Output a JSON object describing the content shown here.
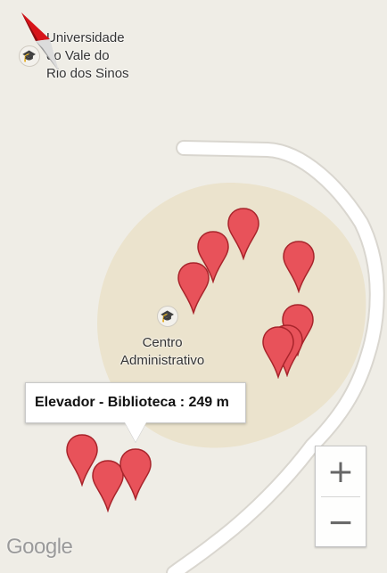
{
  "map": {
    "pois": [
      {
        "label": "Universidade\ndo Vale do\nRio dos Sinos",
        "icon": "graduation-cap-icon"
      },
      {
        "label": "Centro\nAdministrativo",
        "icon": "graduation-cap-icon"
      }
    ],
    "marker_color": "#e8525a",
    "campus_color": "#ebe3cd",
    "road_color": "#ffffff",
    "marker_count": 10
  },
  "info_window": {
    "text": "Elevador - Biblioteca : 249 m"
  },
  "zoom": {
    "in_label": "+",
    "out_label": "−"
  },
  "attribution": {
    "logo_text": "Google"
  },
  "compass": {
    "icon": "compass-icon"
  }
}
